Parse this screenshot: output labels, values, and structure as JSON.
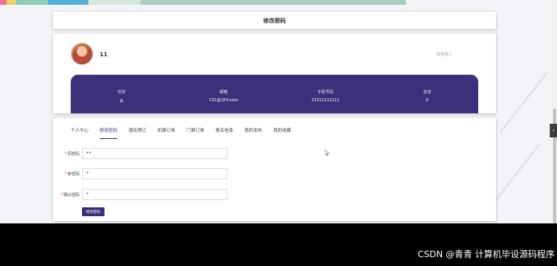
{
  "page": {
    "title": "修改密码"
  },
  "profile": {
    "username": "11",
    "signature": "我我我三",
    "info": [
      {
        "label": "性别",
        "value": "女"
      },
      {
        "label": "邮箱",
        "value": "131@163.com"
      },
      {
        "label": "手机号码",
        "value": "13111111111"
      },
      {
        "label": "状态",
        "value": "0"
      }
    ]
  },
  "tabs": [
    {
      "label": "个人中心",
      "active": false
    },
    {
      "label": "修改密码",
      "active": true
    },
    {
      "label": "酒店预订",
      "active": false
    },
    {
      "label": "机票订单",
      "active": false
    },
    {
      "label": "门票订单",
      "active": false
    },
    {
      "label": "报名信息",
      "active": false
    },
    {
      "label": "我的发布",
      "active": false
    },
    {
      "label": "我的收藏",
      "active": false
    }
  ],
  "form": {
    "old_password": {
      "label": "原密码",
      "value": "••"
    },
    "new_password": {
      "label": "新密码",
      "value": "•"
    },
    "confirm_password": {
      "label": "确认密码",
      "value": "•"
    },
    "submit_label": "修改密码"
  },
  "side_handle_glyph": "‹",
  "watermark": "CSDN @青青   计算机毕设源码程序",
  "colors": {
    "accent": "#3b2f7a",
    "required": "#ee3333"
  }
}
